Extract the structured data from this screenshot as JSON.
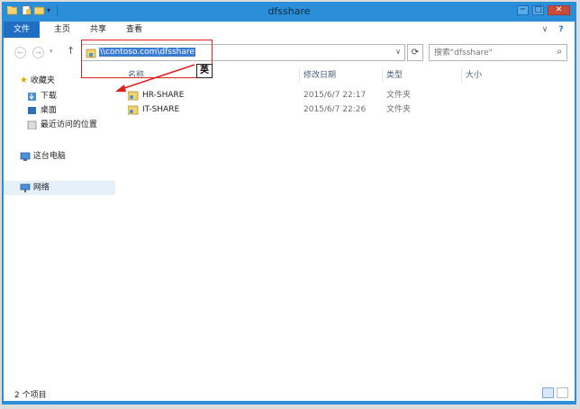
{
  "window": {
    "title": "dfsshare",
    "controls": {
      "minimize": "─",
      "maximize": "□",
      "close": "✕"
    },
    "help": "?",
    "ribbon_toggle": "∨"
  },
  "ribbon": {
    "tabs": [
      {
        "label": "文件"
      },
      {
        "label": "主页"
      },
      {
        "label": "共享"
      },
      {
        "label": "查看"
      }
    ]
  },
  "nav": {
    "back": "←",
    "forward": "→",
    "up": "↑",
    "address": "\\\\contoso.com\\dfsshare",
    "address_dropdown": "∨",
    "refresh": "⟳",
    "search_placeholder": "搜索\"dfsshare\"",
    "search_icon": "⌕"
  },
  "sidebar": {
    "favorites": {
      "label": "收藏夹"
    },
    "items": [
      {
        "label": "下载"
      },
      {
        "label": "桌面"
      },
      {
        "label": "最近访问的位置"
      }
    ],
    "this_pc": {
      "label": "这台电脑"
    },
    "network": {
      "label": "网络"
    }
  },
  "columns": {
    "name": "名称",
    "modified": "修改日期",
    "type": "类型",
    "size": "大小"
  },
  "rows": [
    {
      "name": "HR-SHARE",
      "modified": "2015/6/7 22:17",
      "type": "文件夹",
      "size": ""
    },
    {
      "name": "IT-SHARE",
      "modified": "2015/6/7 22:26",
      "type": "文件夹",
      "size": ""
    }
  ],
  "status": {
    "count": "2 个项目"
  },
  "annotation": {
    "label": "英",
    "color": "#e02020"
  },
  "colors": {
    "frame": "#2a8fd8",
    "file_tab": "#1f6ec1",
    "address_highlight": "#3a7bd5"
  }
}
